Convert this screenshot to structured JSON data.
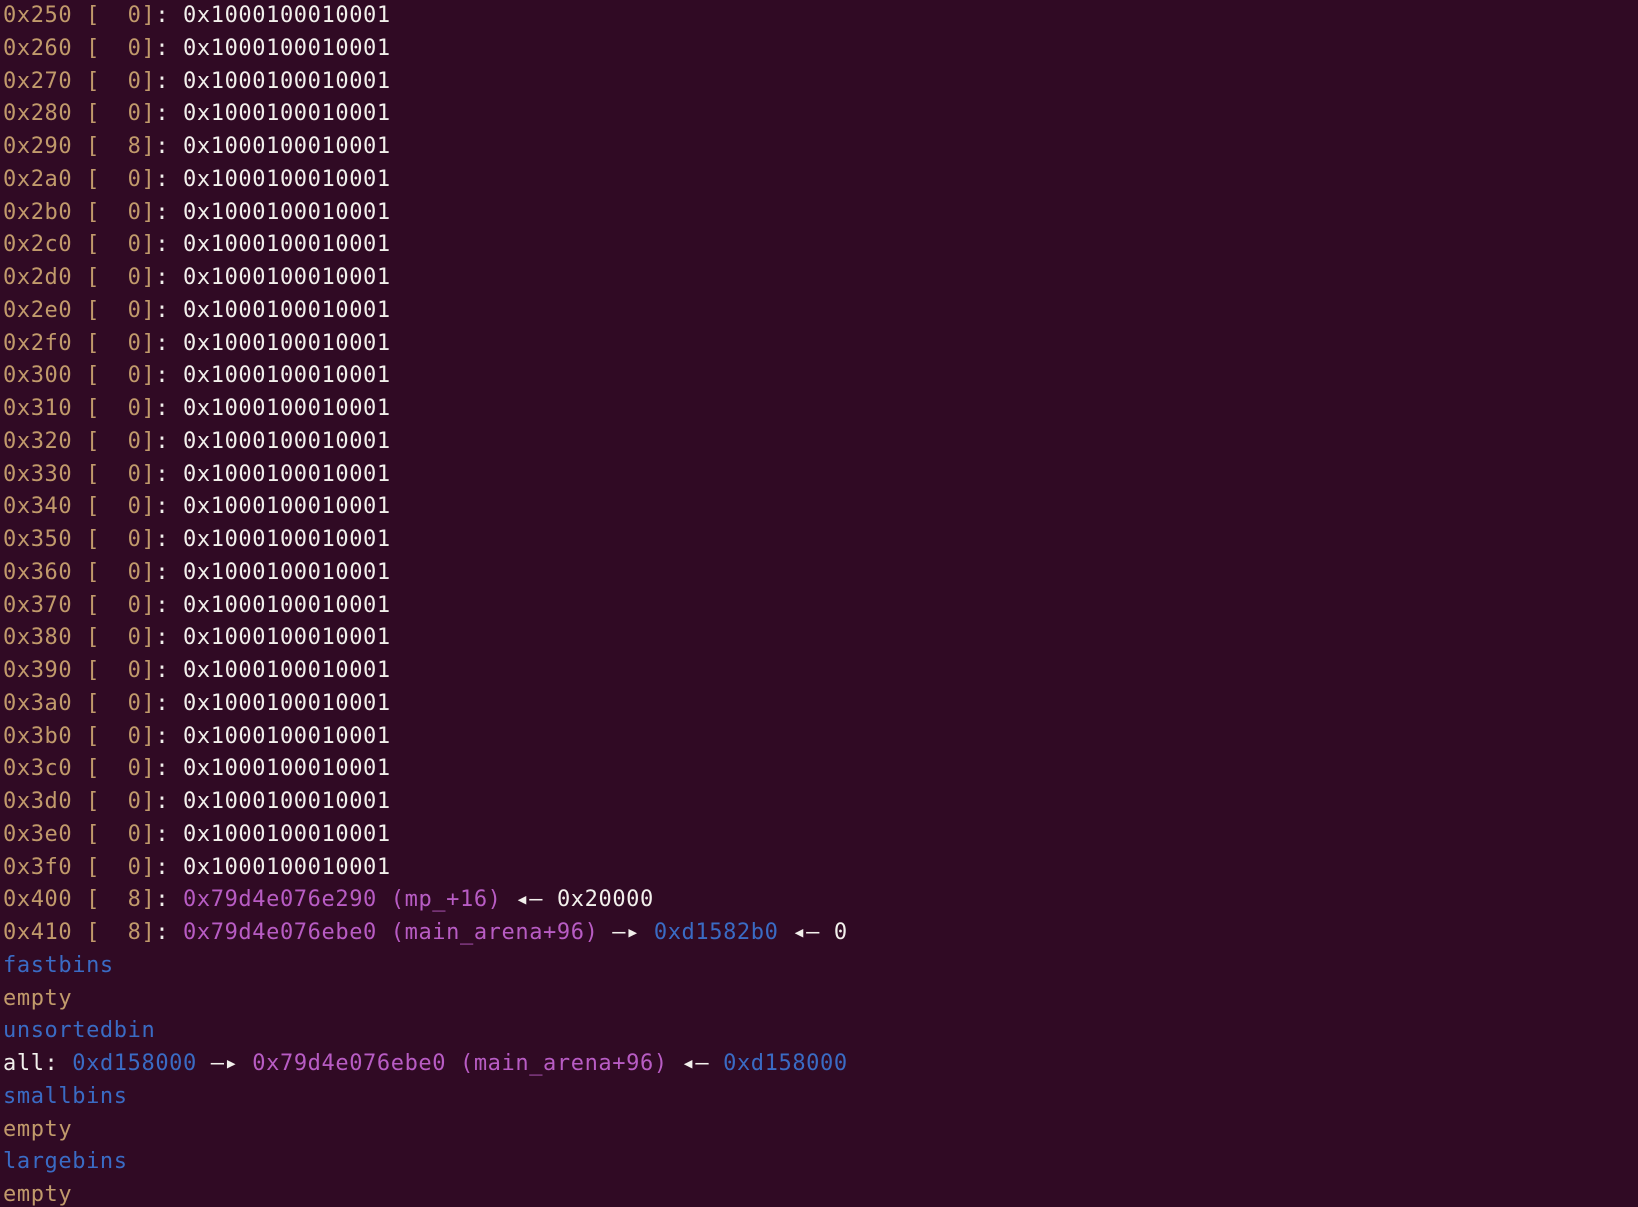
{
  "tcache_entries": [
    {
      "addr": "0x250",
      "count": "0",
      "value": "0x1000100010001"
    },
    {
      "addr": "0x260",
      "count": "0",
      "value": "0x1000100010001"
    },
    {
      "addr": "0x270",
      "count": "0",
      "value": "0x1000100010001"
    },
    {
      "addr": "0x280",
      "count": "0",
      "value": "0x1000100010001"
    },
    {
      "addr": "0x290",
      "count": "8",
      "value": "0x1000100010001"
    },
    {
      "addr": "0x2a0",
      "count": "0",
      "value": "0x1000100010001"
    },
    {
      "addr": "0x2b0",
      "count": "0",
      "value": "0x1000100010001"
    },
    {
      "addr": "0x2c0",
      "count": "0",
      "value": "0x1000100010001"
    },
    {
      "addr": "0x2d0",
      "count": "0",
      "value": "0x1000100010001"
    },
    {
      "addr": "0x2e0",
      "count": "0",
      "value": "0x1000100010001"
    },
    {
      "addr": "0x2f0",
      "count": "0",
      "value": "0x1000100010001"
    },
    {
      "addr": "0x300",
      "count": "0",
      "value": "0x1000100010001"
    },
    {
      "addr": "0x310",
      "count": "0",
      "value": "0x1000100010001"
    },
    {
      "addr": "0x320",
      "count": "0",
      "value": "0x1000100010001"
    },
    {
      "addr": "0x330",
      "count": "0",
      "value": "0x1000100010001"
    },
    {
      "addr": "0x340",
      "count": "0",
      "value": "0x1000100010001"
    },
    {
      "addr": "0x350",
      "count": "0",
      "value": "0x1000100010001"
    },
    {
      "addr": "0x360",
      "count": "0",
      "value": "0x1000100010001"
    },
    {
      "addr": "0x370",
      "count": "0",
      "value": "0x1000100010001"
    },
    {
      "addr": "0x380",
      "count": "0",
      "value": "0x1000100010001"
    },
    {
      "addr": "0x390",
      "count": "0",
      "value": "0x1000100010001"
    },
    {
      "addr": "0x3a0",
      "count": "0",
      "value": "0x1000100010001"
    },
    {
      "addr": "0x3b0",
      "count": "0",
      "value": "0x1000100010001"
    },
    {
      "addr": "0x3c0",
      "count": "0",
      "value": "0x1000100010001"
    },
    {
      "addr": "0x3d0",
      "count": "0",
      "value": "0x1000100010001"
    },
    {
      "addr": "0x3e0",
      "count": "0",
      "value": "0x1000100010001"
    },
    {
      "addr": "0x3f0",
      "count": "0",
      "value": "0x1000100010001"
    }
  ],
  "tcache_chain_1": {
    "addr": "0x400",
    "count": "8",
    "ptr": "0x79d4e076e290",
    "sym": "(mp_+16)",
    "arrow": "◂—",
    "target": "0x20000"
  },
  "tcache_chain_2": {
    "addr": "0x410",
    "count": "8",
    "ptr": "0x79d4e076ebe0",
    "sym": "(main_arena+96)",
    "arrow1": "—▸",
    "next": "0xd1582b0",
    "arrow2": "◂—",
    "target": "0"
  },
  "fastbins": {
    "header": "fastbins",
    "status": "empty"
  },
  "unsortedbin": {
    "header": "unsortedbin",
    "label": "all:",
    "head": "0xd158000",
    "arrow1": "—▸",
    "ptr": "0x79d4e076ebe0",
    "sym": "(main_arena+96)",
    "arrow2": "◂—",
    "tail": "0xd158000"
  },
  "smallbins": {
    "header": "smallbins",
    "status": "empty"
  },
  "largebins": {
    "header": "largebins",
    "status": "empty"
  },
  "colors": {
    "background": "#300a24",
    "address": "#c19a6b",
    "value": "#f2f0ec",
    "pointer": "#b85cc4",
    "heap": "#3a6bc4"
  }
}
